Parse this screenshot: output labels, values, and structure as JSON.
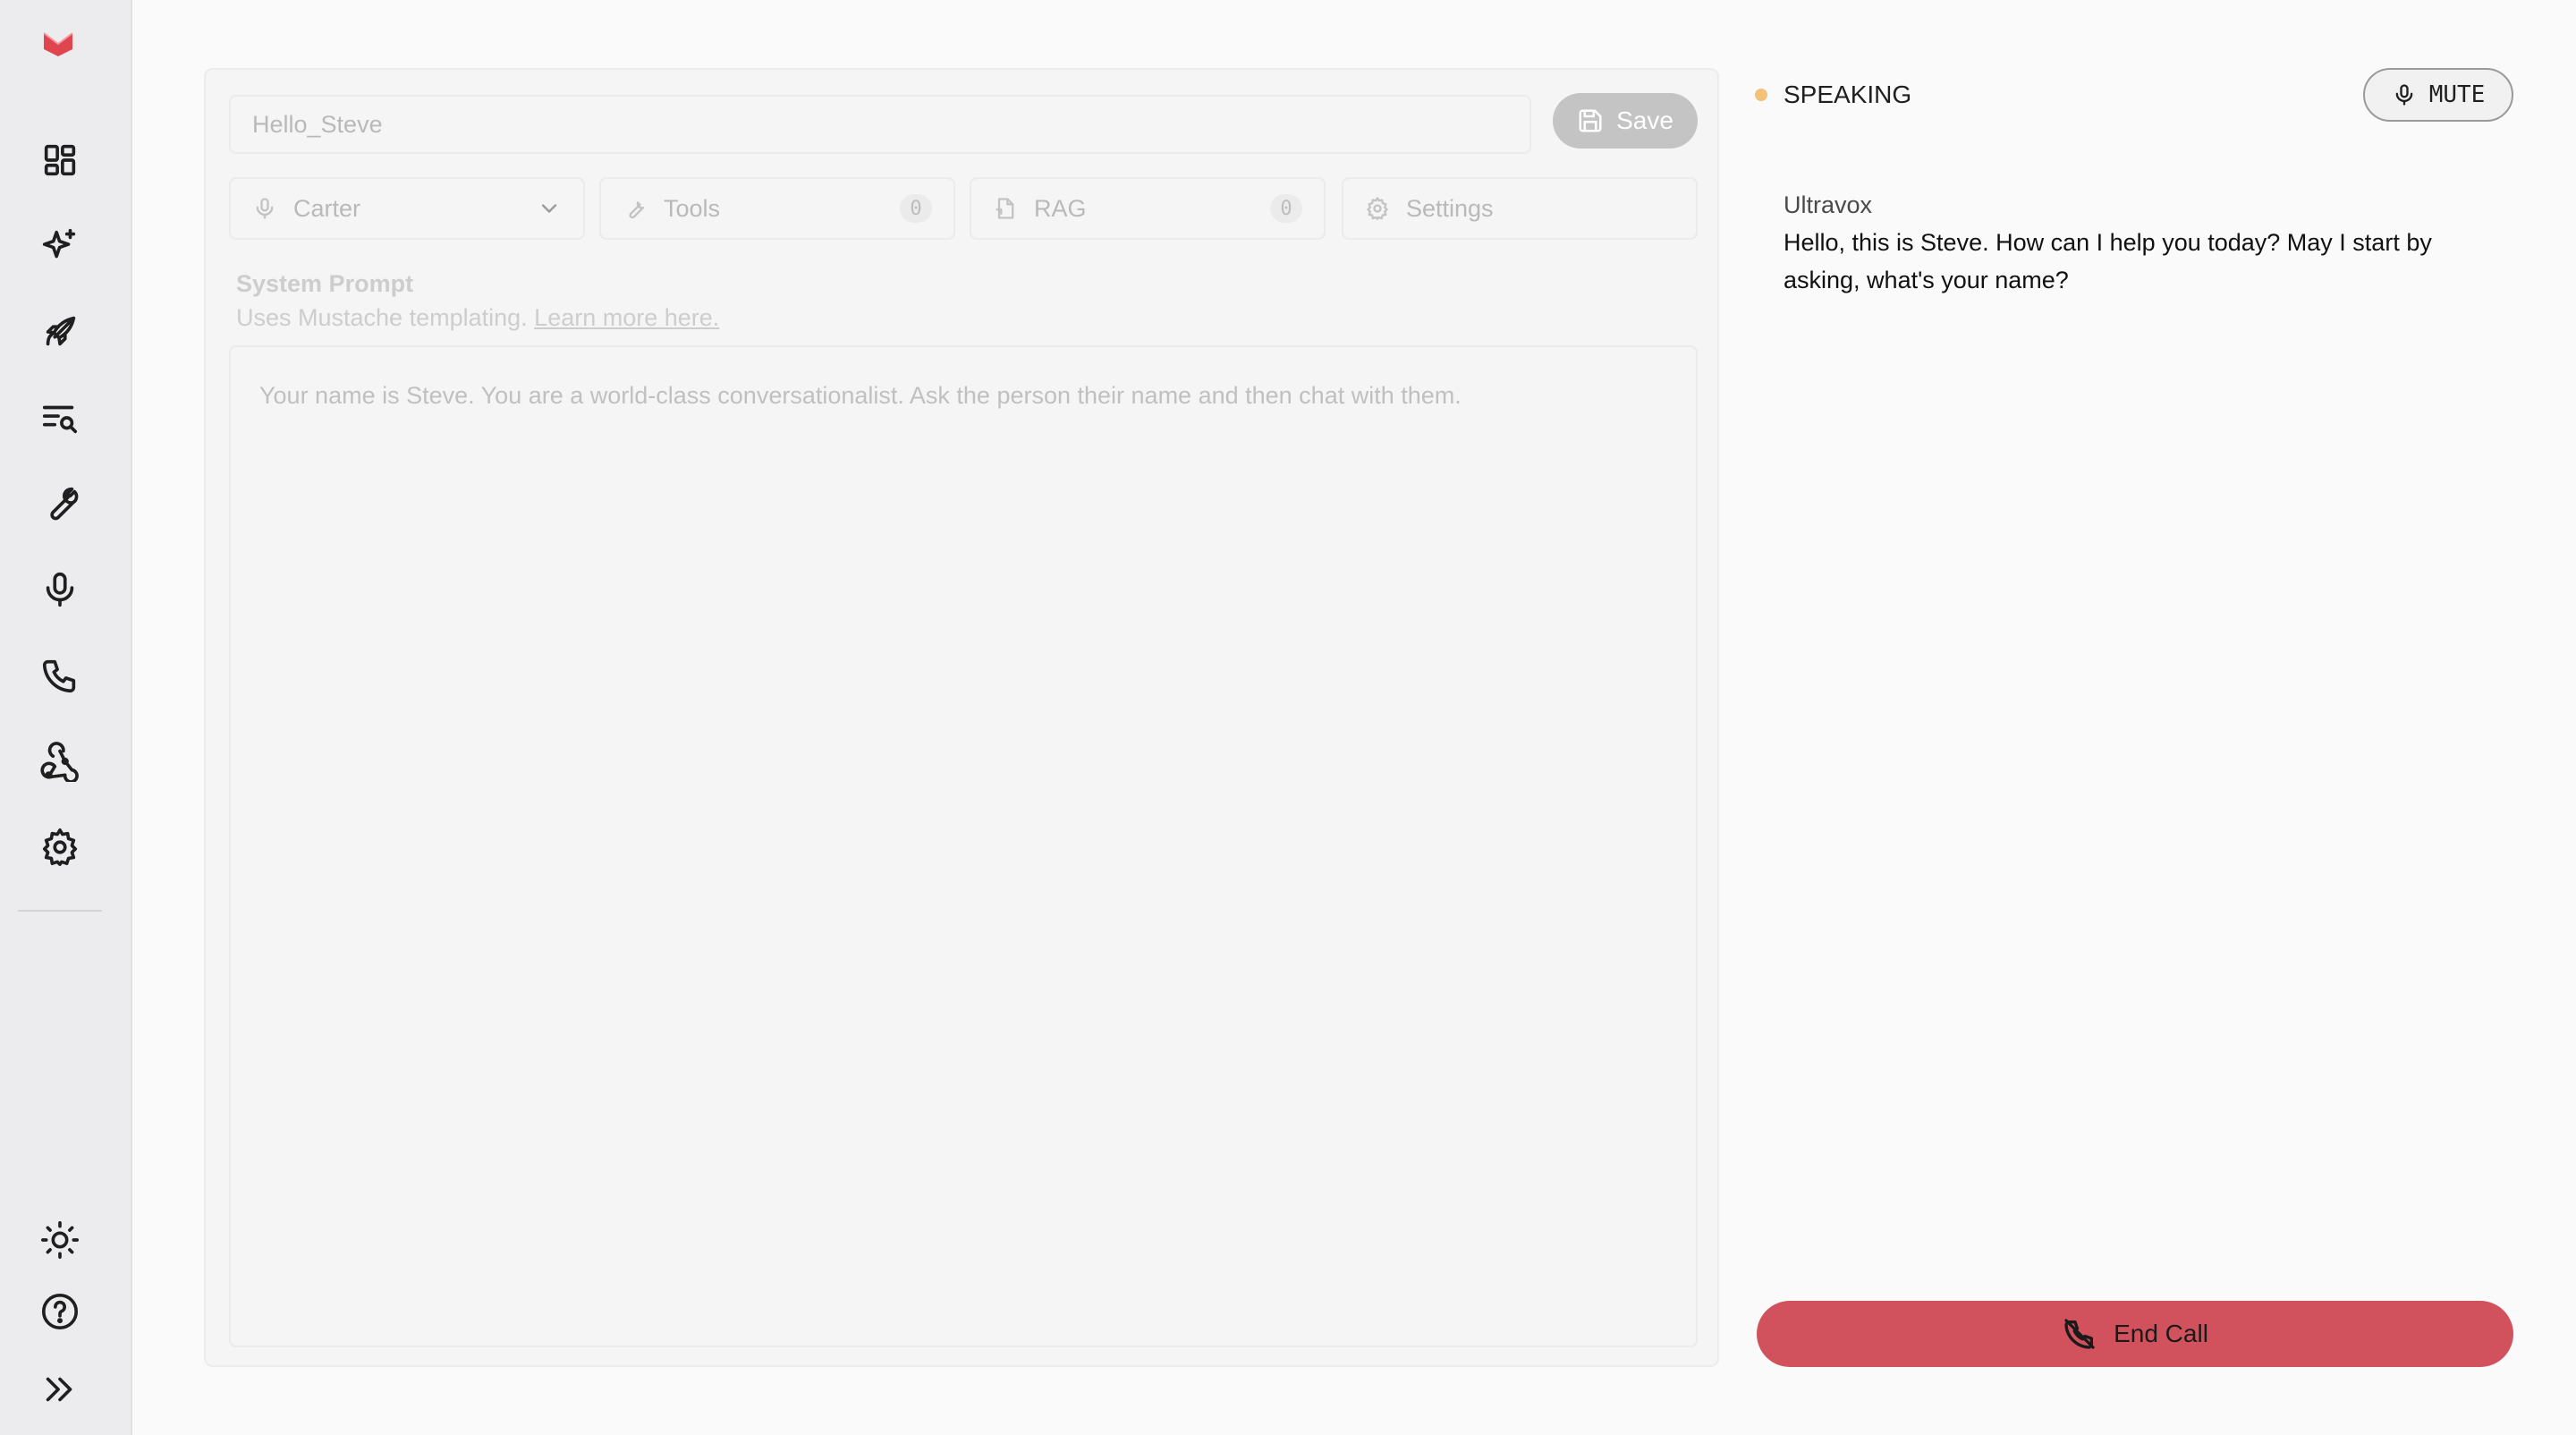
{
  "sidebar": {
    "nav_icons": [
      "dashboard-icon",
      "sparkle-icon",
      "rocket-icon",
      "search-list-icon",
      "wrench-icon",
      "microphone-icon",
      "phone-icon",
      "webhook-icon",
      "gear-icon"
    ],
    "bottom_icons": [
      "sun-icon",
      "help-icon",
      "expand-icon"
    ],
    "accent": "#e0454f"
  },
  "editor": {
    "agent_name": "Hello_Steve",
    "save_label": "Save",
    "voice_label": "Carter",
    "tools_label": "Tools",
    "tools_count": "0",
    "rag_label": "RAG",
    "rag_count": "0",
    "settings_label": "Settings",
    "system_prompt_title": "System Prompt",
    "system_prompt_subtitle": "Uses Mustache templating.",
    "learn_more_link": "Learn more here.",
    "system_prompt_text": "Your name is Steve. You are a world-class conversationalist. Ask the person their name and then chat with them."
  },
  "call": {
    "status": "SPEAKING",
    "status_color": "#f2c27a",
    "mute_label": "MUTE",
    "messages": [
      {
        "speaker": "Ultravox",
        "text": "Hello, this is Steve. How can I help you today? May I start by asking, what's your name?"
      }
    ],
    "end_call_label": "End Call",
    "end_call_color": "#d1525c"
  }
}
